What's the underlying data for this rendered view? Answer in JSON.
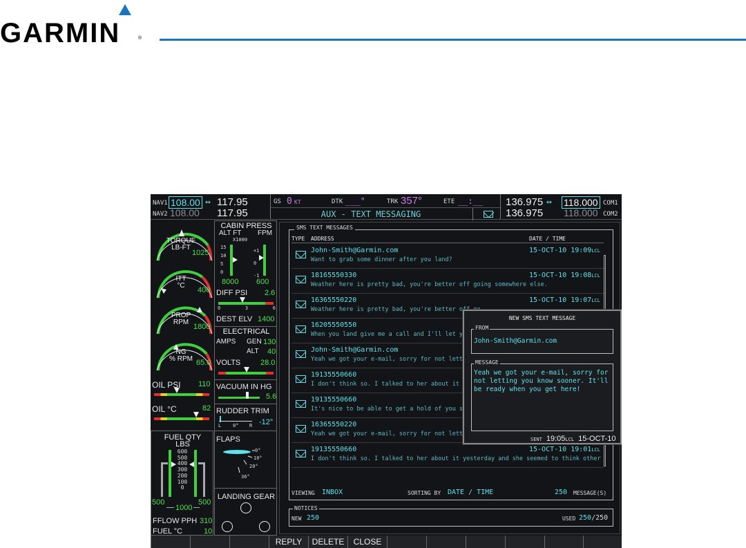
{
  "brand": {
    "name": "GARMIN",
    "reg": "®",
    "accent": "#1a75bc"
  },
  "nav": {
    "nav1_label": "NAV1",
    "nav1_active": "108.00",
    "nav1_arrow": "↔",
    "nav1_standby": "117.95",
    "nav2_label": "NAV2",
    "nav2_active": "108.00",
    "nav2_standby": "117.95"
  },
  "topcenter": {
    "gs_label": "GS",
    "gs_value": "0",
    "gs_unit": "KT",
    "dtk_label": "DTK",
    "dtk_value": "___°",
    "trk_label": "TRK",
    "trk_value": "357°",
    "ete_label": "ETE",
    "ete_value": "__:__",
    "page_title": "AUX - TEXT MESSAGING"
  },
  "com": {
    "com1_standby": "136.975",
    "com1_arrow": "↔",
    "com1_active": "118.000",
    "com1_label": "COM1",
    "com2_standby": "136.975",
    "com2_active": "118.000",
    "com2_label": "COM2"
  },
  "eis": {
    "torque_label": "TORQUE",
    "torque_unit": "LB-FT",
    "torque_value": "1025",
    "itt_label": "ITT",
    "itt_unit": "°C",
    "itt_value": "400",
    "prop_label": "PROP",
    "prop_unit": "RPM",
    "prop_value": "1800",
    "ng_label": "NG",
    "ng_unit": "% RPM",
    "ng_value": "65.0",
    "oilpsi_label": "OIL PSI",
    "oilpsi_value": "110",
    "oilc_label": "OIL °C",
    "oilc_value": "82",
    "fuelqty_label": "FUEL QTY",
    "fuelqty_unit": "LBS",
    "fuel_scale": [
      "600",
      "500",
      "400",
      "300",
      "200",
      "100",
      "0"
    ],
    "fuel_left": "500",
    "fuel_right": "500",
    "fuel_total": "1000",
    "fflow_label": "FFLOW PPH",
    "fflow_value": "310",
    "fuelc_label": "FUEL °C",
    "fuelc_value": "10",
    "cabin_label": "CABIN PRESS",
    "alt_label": "ALT FT",
    "fpm_label": "FPM",
    "x1000": "X1000",
    "alt_scale": [
      "15",
      "10",
      "5",
      "0"
    ],
    "fpm_scale": [
      "+1",
      "0",
      "-1"
    ],
    "cabin_alt": "8000",
    "cabin_fpm": "600",
    "diff_label": "DIFF PSI",
    "diff_value": "2.6",
    "diff_scale": [
      "0",
      "3",
      "6"
    ],
    "dest_label": "DEST ELV",
    "dest_value": "1400",
    "elec_label": "ELECTRICAL",
    "amps_label": "AMPS",
    "gen_label": "GEN",
    "gen_value": "130",
    "alt_label2": "ALT",
    "alt_value": "40",
    "volts_label": "VOLTS",
    "volts_value": "28.0",
    "vac_label": "VACUUM IN HG",
    "vac_value": "5.6",
    "rudder_label": "RUDDER TRIM",
    "rudder_value": "-12°",
    "rudder_l": "L",
    "rudder_0": "0°",
    "rudder_r": "R",
    "flaps_label": "FLAPS",
    "flaps_marks": [
      "0°",
      "10°",
      "20°",
      "36°"
    ],
    "gear_label": "LANDING GEAR"
  },
  "sms": {
    "panel_title": "SMS TEXT MESSAGES",
    "col_type": "TYPE",
    "col_address": "ADDRESS",
    "col_date": "DATE / TIME",
    "messages": [
      {
        "address": "John-Smith@Garmin.com",
        "preview": "Want to grab some dinner after you land?",
        "date": "15-OCT-10",
        "time": "19:09",
        "tz": "LCL"
      },
      {
        "address": "18165550330",
        "preview": "Weather here is pretty bad, you're better off going somewhere else.",
        "date": "15-OCT-10",
        "time": "19:08",
        "tz": "LCL"
      },
      {
        "address": "16365550220",
        "preview": "Weather here is pretty bad, you're better off go",
        "date": "15-OCT-10",
        "time": "19:07",
        "tz": "LCL"
      },
      {
        "address": "16205550550",
        "preview": "When you land give me a call and I'll let you kno",
        "date": "",
        "time": "",
        "tz": ""
      },
      {
        "address": "John-Smith@Garmin.com",
        "preview": "Yeah we got your e-mail, sorry for not letting y",
        "date": "",
        "time": "",
        "tz": ""
      },
      {
        "address": "19135550660",
        "preview": "I don't think so. I talked to her about it yester",
        "date": "",
        "time": "",
        "tz": ""
      },
      {
        "address": "19135550660",
        "preview": "It's nice to be able to get a hold of you so eas",
        "date": "",
        "time": "",
        "tz": ""
      },
      {
        "address": "16365550220",
        "preview": "Yeah we got your e-mail, sorry for not letting yo",
        "date": "",
        "time": "",
        "tz": ""
      },
      {
        "address": "19135550660",
        "preview": "I don't think so. I talked to her about it yesterday and she seemed to think otherwise.",
        "date": "15-OCT-10",
        "time": "19:01",
        "tz": "LCL"
      }
    ],
    "viewing_label": "VIEWING",
    "viewing_value": "INBOX",
    "sorting_label": "SORTING BY",
    "sorting_value": "DATE / TIME",
    "count_value": "250",
    "count_label": "MESSAGE(S)"
  },
  "popup": {
    "title": "NEW SMS TEXT MESSAGE",
    "from_label": "FROM",
    "from_value": "John-Smith@Garmin.com",
    "message_label": "MESSAGE",
    "message_text": "Yeah we got your e-mail, sorry for not letting you know sooner. It'll be ready when you get here!",
    "sent_label": "SENT",
    "sent_time": "19:05",
    "sent_tz": "LCL",
    "sent_date": "15-OCT-10"
  },
  "notices": {
    "title": "NOTICES",
    "new_label": "NEW",
    "new_value": "250",
    "used_label": "USED",
    "used_value": "250",
    "used_total": "/250"
  },
  "softkeys": [
    "",
    "",
    "",
    "REPLY",
    "DELETE",
    "CLOSE",
    "",
    "",
    "",
    "",
    "",
    ""
  ]
}
